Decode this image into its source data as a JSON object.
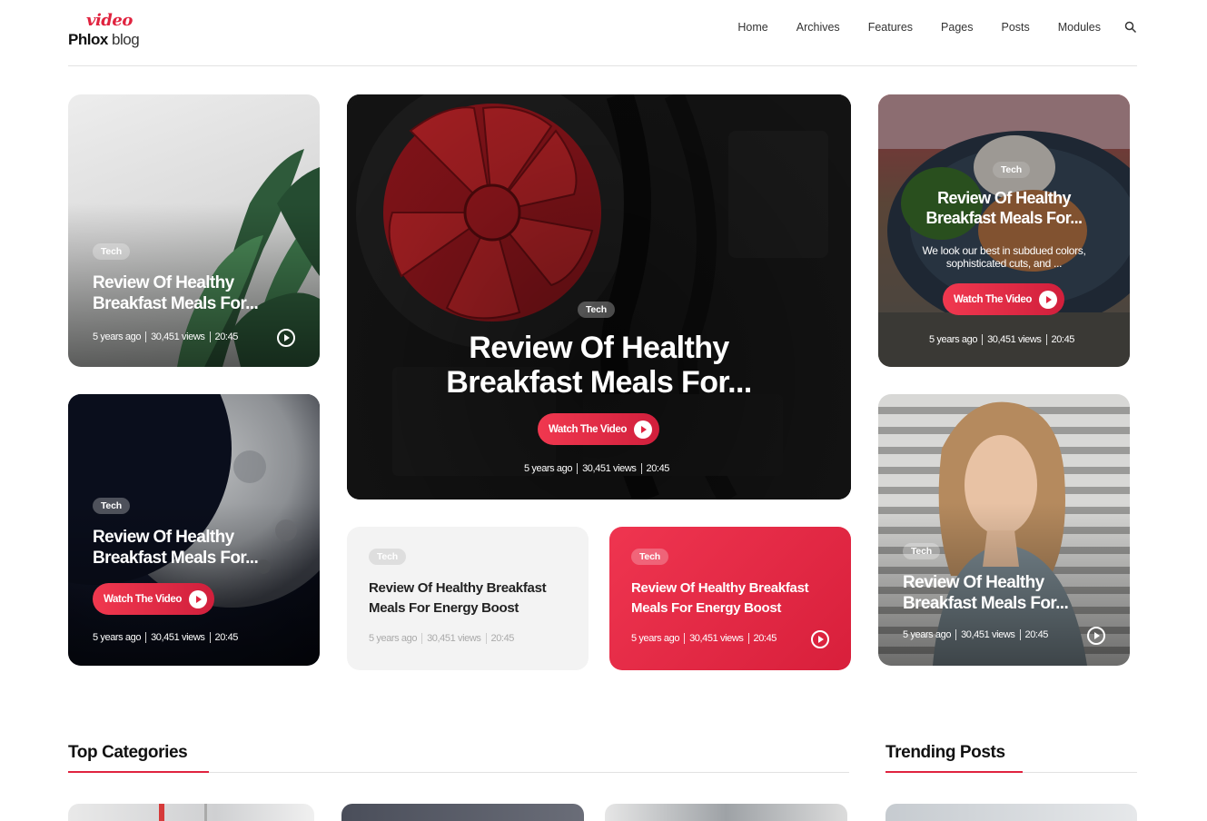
{
  "brand": {
    "script": "video",
    "name": "Phlox",
    "suffix": "blog"
  },
  "nav": {
    "items": [
      "Home",
      "Archives",
      "Features",
      "Pages",
      "Posts",
      "Modules"
    ]
  },
  "colors": {
    "accent": "#e0233f",
    "card_light_bg": "#f3f3f3"
  },
  "cards": {
    "c1": {
      "tag": "Tech",
      "title_l1": "Review Of Healthy",
      "title_l2": "Breakfast Meals For...",
      "date": "5 years ago",
      "views": "30,451 views",
      "duration": "20:45"
    },
    "c2": {
      "tag": "Tech",
      "title_l1": "Review Of Healthy",
      "title_l2": "Breakfast Meals For...",
      "date": "5 years ago",
      "views": "30,451 views",
      "duration": "20:45",
      "watch": "Watch The Video"
    },
    "c3": {
      "tag": "Tech",
      "title_l1": "Review Of Healthy",
      "title_l2": "Breakfast Meals For...",
      "date": "5 years ago",
      "views": "30,451 views",
      "duration": "20:45",
      "watch": "Watch The Video"
    },
    "c4": {
      "tag": "Tech",
      "title_l1": "Review Of Healthy Breakfast",
      "title_l2": "Meals For Energy Boost",
      "date": "5 years ago",
      "views": "30,451 views",
      "duration": "20:45"
    },
    "c5": {
      "tag": "Tech",
      "title_l1": "Review Of Healthy Breakfast",
      "title_l2": "Meals For Energy Boost",
      "date": "5 years ago",
      "views": "30,451 views",
      "duration": "20:45"
    },
    "c6": {
      "tag": "Tech",
      "title_l1": "Review Of Healthy",
      "title_l2": "Breakfast Meals For...",
      "excerpt_l1": "We look our best in subdued colors,",
      "excerpt_l2": "sophisticated cuts, and ...",
      "date": "5 years ago",
      "views": "30,451 views",
      "duration": "20:45",
      "watch": "Watch The Video"
    },
    "c7": {
      "tag": "Tech",
      "title_l1": "Review Of Healthy",
      "title_l2": "Breakfast Meals For...",
      "date": "5 years ago",
      "views": "30,451 views",
      "duration": "20:45"
    }
  },
  "sections": {
    "top_categories": "Top Categories",
    "trending_posts": "Trending Posts"
  }
}
